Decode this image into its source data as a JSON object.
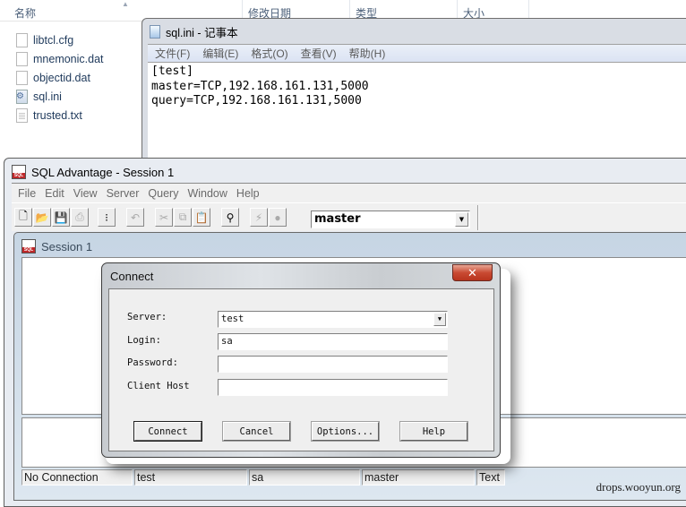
{
  "explorer": {
    "columns": [
      {
        "label": "名称"
      },
      {
        "label": "修改日期"
      },
      {
        "label": "类型"
      },
      {
        "label": "大小"
      }
    ],
    "files": [
      {
        "name": "libtcl.cfg",
        "icon": "file-icon"
      },
      {
        "name": "mnemonic.dat",
        "icon": "file-icon"
      },
      {
        "name": "objectid.dat",
        "icon": "file-icon"
      },
      {
        "name": "sql.ini",
        "icon": "settings-file-icon"
      },
      {
        "name": "trusted.txt",
        "icon": "text-file-icon"
      }
    ]
  },
  "notepad": {
    "title": "sql.ini - 记事本",
    "menu": [
      "文件(F)",
      "编辑(E)",
      "格式(O)",
      "查看(V)",
      "帮助(H)"
    ],
    "content": "[test]\nmaster=TCP,192.168.161.131,5000\nquery=TCP,192.168.161.131,5000"
  },
  "sql_advantage": {
    "title": "SQL Advantage - Session 1",
    "menu": [
      "File",
      "Edit",
      "View",
      "Server",
      "Query",
      "Window",
      "Help"
    ],
    "toolbar": {
      "database": "master",
      "buttons": [
        {
          "icon": "new-file-icon",
          "glyph": "🗋",
          "enabled": true
        },
        {
          "icon": "open-folder-icon",
          "glyph": "📂",
          "enabled": true
        },
        {
          "icon": "save-icon",
          "glyph": "💾",
          "enabled": true
        },
        {
          "icon": "print-icon",
          "glyph": "⎙",
          "enabled": false
        },
        {
          "icon": "options-icon",
          "glyph": "⁝",
          "enabled": true
        },
        {
          "icon": "undo-icon",
          "glyph": "↶",
          "enabled": false
        },
        {
          "icon": "cut-icon",
          "glyph": "✂",
          "enabled": false
        },
        {
          "icon": "copy-icon",
          "glyph": "⧉",
          "enabled": false
        },
        {
          "icon": "paste-icon",
          "glyph": "📋",
          "enabled": true
        },
        {
          "icon": "find-icon",
          "glyph": "⚲",
          "enabled": true
        },
        {
          "icon": "execute-icon",
          "glyph": "⚡",
          "enabled": false
        },
        {
          "icon": "stop-icon",
          "glyph": "●",
          "enabled": false
        }
      ]
    },
    "session": {
      "title": "Session 1"
    },
    "status": [
      "No Connection",
      "test",
      "sa",
      "master",
      "Text"
    ]
  },
  "connect_dialog": {
    "title": "Connect",
    "close": "✕",
    "fields": {
      "server": {
        "label": "Server:",
        "value": "test"
      },
      "login": {
        "label": "Login:",
        "value": "sa"
      },
      "password": {
        "label": "Password:",
        "value": ""
      },
      "client_host": {
        "label": "Client Host",
        "value": ""
      }
    },
    "buttons": {
      "connect": "Connect",
      "cancel": "Cancel",
      "options": "Options...",
      "help": "Help"
    }
  },
  "watermark": "drops.wooyun.org"
}
